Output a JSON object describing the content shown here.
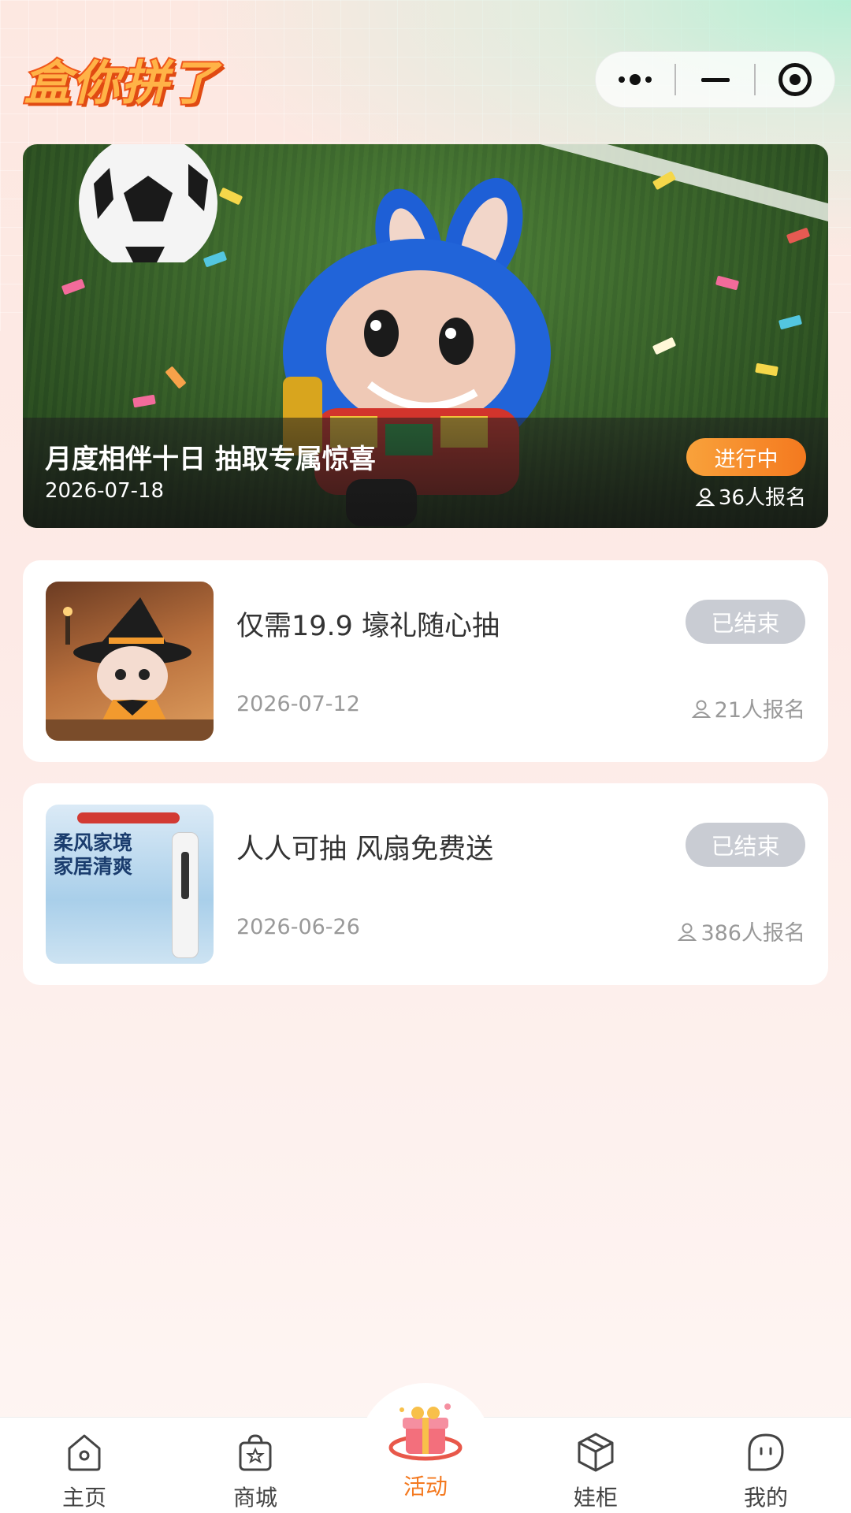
{
  "header": {
    "logo_text": "盒你拼了",
    "capsule": {
      "more_icon": "more-dots-icon",
      "minimize_icon": "minimize-icon",
      "close_icon": "target-close-icon"
    }
  },
  "featured": {
    "title": "月度相伴十日 抽取专属惊喜",
    "date": "2026-07-18",
    "status": "进行中",
    "signup_count": "36人报名"
  },
  "activities": [
    {
      "title": "仅需19.9 壕礼随心抽",
      "date": "2026-07-12",
      "status": "已结束",
      "signup_count": "21人报名"
    },
    {
      "title": "人人可抽 风扇免费送",
      "date": "2026-06-26",
      "status": "已结束",
      "signup_count": "386人报名",
      "thumb_text_1": "柔风家境",
      "thumb_text_2": "家居清爽"
    }
  ],
  "tabbar": {
    "items": [
      {
        "label": "主页",
        "icon": "home-icon"
      },
      {
        "label": "商城",
        "icon": "shop-bag-icon"
      },
      {
        "label": "活动",
        "icon": "gift-icon",
        "active": true
      },
      {
        "label": "娃柜",
        "icon": "box-icon"
      },
      {
        "label": "我的",
        "icon": "profile-icon"
      }
    ]
  },
  "colors": {
    "accent": "#f4791f",
    "ended_badge": "#c9ccd3"
  }
}
